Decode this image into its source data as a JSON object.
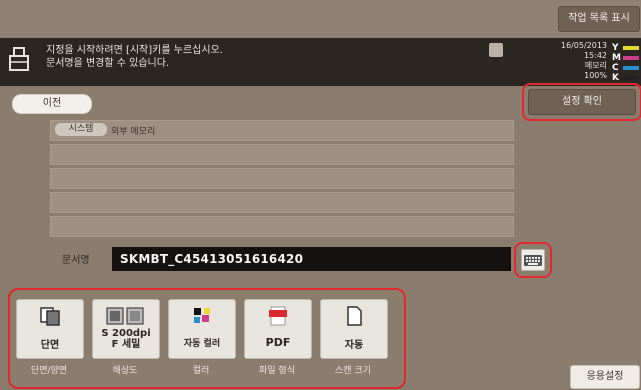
{
  "header": {
    "job_list_label": "작업 목록 표시"
  },
  "message": {
    "line1": "지정을 시작하려면 [시작]키를 누르십시오.",
    "line2": "문서명을 변경할 수 있습니다."
  },
  "status": {
    "date": "16/05/2013",
    "time": "15:42",
    "memory_label": "메모리",
    "memory_value": "100%",
    "toner": [
      {
        "letter": "Y",
        "color": "#e8d832"
      },
      {
        "letter": "M",
        "color": "#d03c8c"
      },
      {
        "letter": "C",
        "color": "#2a8fd0"
      },
      {
        "letter": "K",
        "color": "#222222"
      }
    ]
  },
  "nav": {
    "back_label": "이전",
    "confirm_label": "설정 확인"
  },
  "destination": {
    "tag": "시스템",
    "name": "외부 메모리"
  },
  "filename": {
    "label": "문서명",
    "value": "SKMBT_C45413051616420"
  },
  "functions": [
    {
      "label": "단면",
      "caption": "단면/양면"
    },
    {
      "label_line1": "S 200dpi",
      "label_line2": "F 세밀",
      "caption": "해상도"
    },
    {
      "label": "자동 컬러",
      "caption": "컬러"
    },
    {
      "label": "PDF",
      "caption": "파일 형식"
    },
    {
      "label": "자동",
      "caption": "스캔 크기"
    }
  ],
  "apply_label": "응용설정"
}
